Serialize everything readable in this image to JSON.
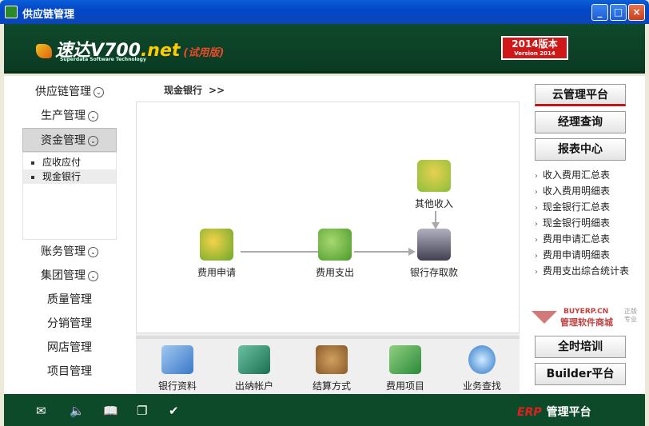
{
  "window": {
    "title": "供应链管理"
  },
  "header": {
    "logo_text": "速达V700",
    "logo_suffix": ".net",
    "trial_label": "(试用版)",
    "logo_sub": "Superdata Software Technology",
    "version_badge_line1": "2014版本",
    "version_badge_line2": "Version 2014"
  },
  "sidebar": {
    "items": [
      {
        "label": "供应链管理",
        "has_chevron": true
      },
      {
        "label": "生产管理",
        "has_chevron": true
      },
      {
        "label": "资金管理",
        "has_chevron": true,
        "active": true
      },
      {
        "label": "账务管理",
        "has_chevron": true
      },
      {
        "label": "集团管理",
        "has_chevron": true
      },
      {
        "label": "质量管理"
      },
      {
        "label": "分销管理"
      },
      {
        "label": "网店管理"
      },
      {
        "label": "项目管理"
      }
    ],
    "sub_items": [
      {
        "label": "应收应付"
      },
      {
        "label": "现金银行",
        "selected": true
      }
    ]
  },
  "breadcrumb": {
    "label": "现金银行",
    "arrow": ">>"
  },
  "flow": {
    "nodes": [
      {
        "label": "费用申请",
        "icon": "expense-apply-icon"
      },
      {
        "label": "费用支出",
        "icon": "expense-pay-icon"
      },
      {
        "label": "其他收入",
        "icon": "other-income-icon"
      },
      {
        "label": "银行存取款",
        "icon": "bank-deposit-icon"
      }
    ]
  },
  "toolbar": {
    "items": [
      {
        "label": "银行资料",
        "icon": "bank-info-icon"
      },
      {
        "label": "出纳帐户",
        "icon": "cashier-account-icon"
      },
      {
        "label": "结算方式",
        "icon": "settlement-method-icon"
      },
      {
        "label": "费用项目",
        "icon": "expense-item-icon"
      },
      {
        "label": "业务查找",
        "icon": "search-icon"
      }
    ]
  },
  "right": {
    "buttons_top": [
      {
        "label": "云管理平台"
      },
      {
        "label": "经理查询"
      },
      {
        "label": "报表中心"
      }
    ],
    "links": [
      "收入费用汇总表",
      "收入费用明细表",
      "现金银行汇总表",
      "现金银行明细表",
      "费用申请汇总表",
      "费用申请明细表",
      "费用支出综合统计表"
    ],
    "brand": {
      "domain": "BUYERP.CN",
      "name": "管理软件商城",
      "tag1": "正版",
      "tag2": "专业"
    },
    "buttons_bottom": [
      {
        "label": "全时培训"
      },
      {
        "label": "Builder平台"
      }
    ]
  },
  "footer": {
    "icons": [
      "mail-icon",
      "sound-icon",
      "book-icon",
      "copy-icon",
      "check-icon"
    ],
    "logo_erp": "ERP",
    "logo_text": "管理平台"
  },
  "colors": {
    "header_bg": "#0f4a2c",
    "accent_red": "#d01818",
    "titlebar": "#0347c8"
  }
}
